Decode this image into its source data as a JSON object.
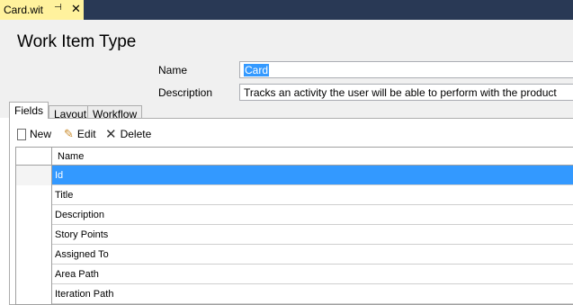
{
  "document_tab": {
    "title": "Card.wit",
    "pin_glyph": "⊣",
    "close_glyph": "✕"
  },
  "page_title": "Work Item Type",
  "form": {
    "name_label": "Name",
    "name_value": "Card",
    "description_label": "Description",
    "description_value": "Tracks an activity the user will be able to perform with the product"
  },
  "tabs": [
    {
      "label": "Fields",
      "active": true
    },
    {
      "label": "Layout",
      "active": false
    },
    {
      "label": "Workflow",
      "active": false
    }
  ],
  "toolbar": {
    "new_label": "New",
    "edit_label": "Edit",
    "delete_label": "Delete"
  },
  "grid": {
    "column_header": "Name",
    "rows": [
      "Id",
      "Title",
      "Description",
      "Story Points",
      "Assigned To",
      "Area Path",
      "Iteration Path"
    ],
    "selected_index": 0
  },
  "colors": {
    "accent_dark": "#293955",
    "tab_active": "#fff29d",
    "selection": "#3399ff"
  }
}
